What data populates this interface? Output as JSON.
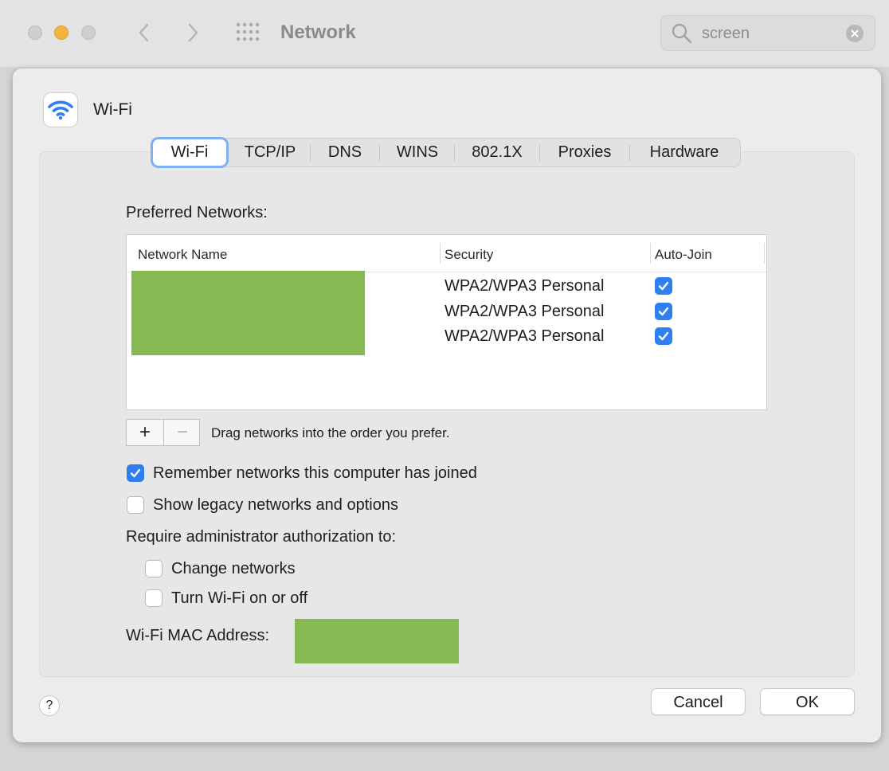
{
  "window": {
    "title": "Network",
    "search_value": "screen"
  },
  "sheet": {
    "service_title": "Wi-Fi",
    "tabs": [
      "Wi-Fi",
      "TCP/IP",
      "DNS",
      "WINS",
      "802.1X",
      "Proxies",
      "Hardware"
    ],
    "active_tab": "Wi-Fi",
    "preferred_networks_label": "Preferred Networks:",
    "table": {
      "columns": [
        "Network Name",
        "Security",
        "Auto-Join"
      ],
      "rows": [
        {
          "network_name": "[redacted]",
          "security": "WPA2/WPA3 Personal",
          "auto_join": true
        },
        {
          "network_name": "[redacted]",
          "security": "WPA2/WPA3 Personal",
          "auto_join": true
        },
        {
          "network_name": "[redacted]",
          "security": "WPA2/WPA3 Personal",
          "auto_join": true
        }
      ]
    },
    "add_label": "+",
    "remove_label": "−",
    "drag_hint": "Drag networks into the order you prefer.",
    "options": {
      "remember_networks": {
        "label": "Remember networks this computer has joined",
        "checked": true
      },
      "show_legacy": {
        "label": "Show legacy networks and options",
        "checked": false
      }
    },
    "require_admin_label": "Require administrator authorization to:",
    "admin_options": {
      "change_networks": {
        "label": "Change networks",
        "checked": false
      },
      "turn_wifi": {
        "label": "Turn Wi-Fi on or off",
        "checked": false
      }
    },
    "mac_address_label": "Wi-Fi MAC Address:",
    "mac_address_value": "[redacted]",
    "help_label": "?",
    "cancel_label": "Cancel",
    "ok_label": "OK"
  },
  "colors": {
    "accent": "#2f7ff0",
    "redaction": "#87b952",
    "minimize_light": "#f5b43c"
  },
  "icons": [
    "chevron-left-icon",
    "chevron-right-icon",
    "grid-icon",
    "search-icon",
    "clear-icon",
    "wifi-icon",
    "checkmark-icon",
    "help-icon"
  ]
}
